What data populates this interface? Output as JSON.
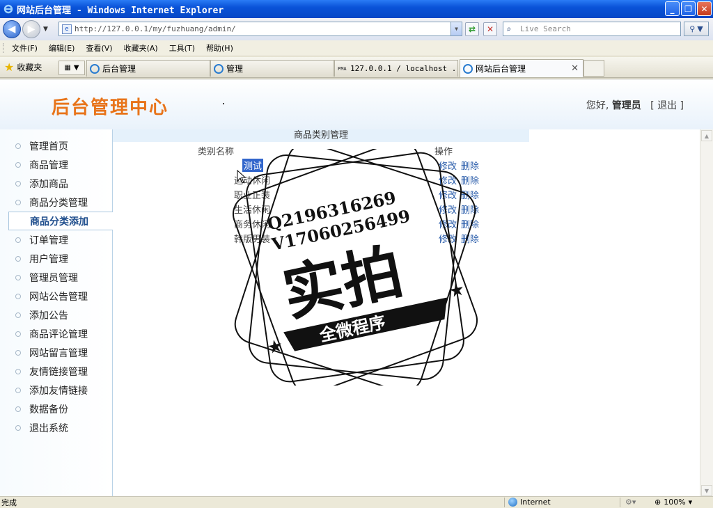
{
  "window": {
    "title": "网站后台管理 - Windows Internet Explorer",
    "controls": [
      "minimize",
      "restore",
      "close"
    ]
  },
  "toolbar": {
    "address": "http://127.0.0.1/my/fuzhuang/admin/",
    "search_placeholder": "Live Search"
  },
  "menu": [
    "文件(F)",
    "编辑(E)",
    "查看(V)",
    "收藏夹(A)",
    "工具(T)",
    "帮助(H)"
  ],
  "favorites": {
    "label": "收藏夹"
  },
  "tabs": [
    {
      "label": "后台管理",
      "active": false
    },
    {
      "label": "管理",
      "active": false
    },
    {
      "label": "127.0.0.1 / localhost ...",
      "active": false
    },
    {
      "label": "网站后台管理",
      "active": true
    }
  ],
  "header": {
    "brand": "后台管理中心",
    "greeting": "您好,",
    "username": "管理员",
    "logout": "[ 退出 ]"
  },
  "sidebar": {
    "items": [
      {
        "label": "管理首页",
        "selected": false
      },
      {
        "label": "商品管理",
        "selected": false
      },
      {
        "label": "添加商品",
        "selected": false
      },
      {
        "label": "商品分类管理",
        "selected": false
      },
      {
        "label": "商品分类添加",
        "selected": true
      },
      {
        "label": "订单管理",
        "selected": false
      },
      {
        "label": "用户管理",
        "selected": false
      },
      {
        "label": "管理员管理",
        "selected": false
      },
      {
        "label": "网站公告管理",
        "selected": false
      },
      {
        "label": "添加公告",
        "selected": false
      },
      {
        "label": "商品评论管理",
        "selected": false
      },
      {
        "label": "网站留言管理",
        "selected": false
      },
      {
        "label": "友情链接管理",
        "selected": false
      },
      {
        "label": "添加友情链接",
        "selected": false
      },
      {
        "label": "数据备份",
        "selected": false
      },
      {
        "label": "退出系统",
        "selected": false
      }
    ]
  },
  "main": {
    "title": "商品类别管理",
    "columns": {
      "name": "类别名称",
      "ops": "操作"
    },
    "rows": [
      {
        "name": "测试",
        "edit": "修改",
        "del": "删除",
        "highlighted": true
      },
      {
        "name": "运动休闲",
        "edit": "修改",
        "del": "删除",
        "highlighted": false
      },
      {
        "name": "职业正装",
        "edit": "修改",
        "del": "删除",
        "highlighted": false
      },
      {
        "name": "生活休闲",
        "edit": "修改",
        "del": "删除",
        "highlighted": false
      },
      {
        "name": "商务休闲",
        "edit": "修改",
        "del": "删除",
        "highlighted": false
      },
      {
        "name": "韩版男装",
        "edit": "修改",
        "del": "删除",
        "highlighted": false
      }
    ]
  },
  "watermark": {
    "line1": "Q2196316269",
    "line2": "V17060256499",
    "main": "实拍",
    "banner": "全微程序"
  },
  "status": {
    "text": "完成",
    "zone": "Internet",
    "zoom": "100%"
  },
  "colors": {
    "titlebar": "#0A53D8",
    "brand": "#E8741A",
    "link": "#2458A8",
    "selection": "#3266CC"
  }
}
